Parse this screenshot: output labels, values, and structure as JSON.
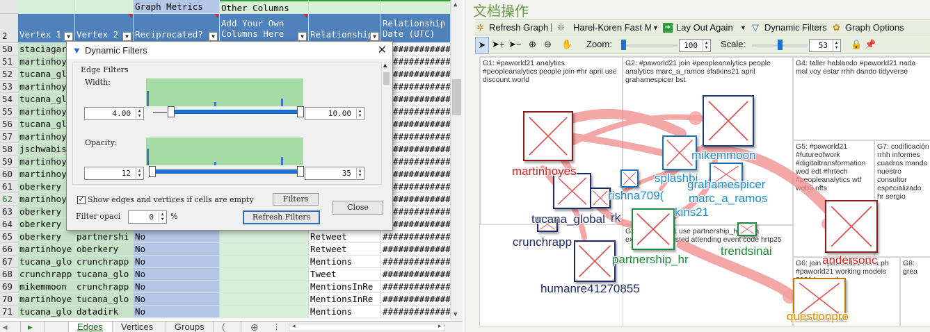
{
  "sheet": {
    "group_headers": {
      "graph_metrics": "Graph Metrics",
      "other_columns": "Other Columns"
    },
    "header_row_number": "2",
    "columns": [
      "Vertex 1",
      "Vertex 2",
      "Reciprocated?",
      "Add Your Own Columns Here",
      "Relationship",
      "Relationship Date (UTC)"
    ],
    "rows": [
      {
        "n": "50",
        "v1": "staciagar",
        "v2": "",
        "rec": "",
        "rel": "",
        "date": "#############"
      },
      {
        "n": "51",
        "v1": "martinhoy",
        "v2": "",
        "rec": "",
        "rel": "",
        "date": "#############"
      },
      {
        "n": "52",
        "v1": "tucana_gl",
        "v2": "",
        "rec": "",
        "rel": "",
        "date": "#############"
      },
      {
        "n": "53",
        "v1": "martinhoy",
        "v2": "",
        "rec": "",
        "rel": "",
        "date": "#############"
      },
      {
        "n": "54",
        "v1": "tucana_gl",
        "v2": "",
        "rec": "",
        "rel": "",
        "date": "#############"
      },
      {
        "n": "55",
        "v1": "martinhoy",
        "v2": "",
        "rec": "",
        "rel": "",
        "date": "#############"
      },
      {
        "n": "56",
        "v1": "tucana_gl",
        "v2": "",
        "rec": "",
        "rel": "",
        "date": "#############"
      },
      {
        "n": "57",
        "v1": "martinhoy",
        "v2": "",
        "rec": "",
        "rel": "",
        "date": "#############"
      },
      {
        "n": "58",
        "v1": "jschwabis",
        "v2": "",
        "rec": "",
        "rel": "",
        "date": "#############"
      },
      {
        "n": "59",
        "v1": "martinhoy",
        "v2": "",
        "rec": "",
        "rel": "",
        "date": "#############"
      },
      {
        "n": "60",
        "v1": "martinhoy",
        "v2": "",
        "rec": "",
        "rel": "",
        "date": "#############"
      },
      {
        "n": "61",
        "v1": "oberkery",
        "v2": "",
        "rec": "",
        "rel": "",
        "date": "#############"
      },
      {
        "n": "62",
        "v1": "martinhoy",
        "v2": "",
        "rec": "",
        "rel": "",
        "date": "#############"
      },
      {
        "n": "63",
        "v1": "oberkery",
        "v2": "",
        "rec": "",
        "rel": "",
        "date": "#############"
      },
      {
        "n": "64",
        "v1": "oberkery",
        "v2": "",
        "rec": "",
        "rel": "",
        "date": "#############"
      },
      {
        "n": "65",
        "v1": "oberkery",
        "v2": "partnershi",
        "rec": "No",
        "rel": "Retweet",
        "date": "#############"
      },
      {
        "n": "66",
        "v1": "martinhoye",
        "v2": "oberkery",
        "rec": "No",
        "rel": "Retweet",
        "date": "#############"
      },
      {
        "n": "67",
        "v1": "tucana_glo",
        "v2": "crunchrapp",
        "rec": "No",
        "rel": "Mentions",
        "date": "#############"
      },
      {
        "n": "68",
        "v1": "crunchrapp",
        "v2": "tucana_glo",
        "rec": "No",
        "rel": "Tweet",
        "date": "#############"
      },
      {
        "n": "69",
        "v1": "mikemmoon",
        "v2": "crunchrapp",
        "rec": "No",
        "rel": "MentionsInRe",
        "date": "#############"
      },
      {
        "n": "70",
        "v1": "martinhoye",
        "v2": "tucana_glo",
        "rec": "No",
        "rel": "MentionsInRe",
        "date": "#############"
      },
      {
        "n": "71",
        "v1": "tucana_glo",
        "v2": "datadirk",
        "rec": "No",
        "rel": "Mentions",
        "date": "#############"
      }
    ],
    "tabs": [
      "Edges",
      "Vertices",
      "Groups",
      "("
    ]
  },
  "dialog": {
    "title": "Dynamic Filters",
    "edge_filters_label": "Edge Filters",
    "width_label": "Width:",
    "width_min": "4.00",
    "width_max": "10.00",
    "opacity_label": "Opacity:",
    "opacity_min": "12",
    "opacity_max": "35",
    "width_hist": [
      0.55,
      0.15,
      0.28
    ],
    "opacity_hist": [
      0.6,
      0.12,
      0.3
    ],
    "show_empty_label": "Show edges and vertices if cells are empty",
    "show_empty_checked": true,
    "filters_button": "Filters",
    "filter_opacity_label": "Filter opaci",
    "filter_opacity_value": "0",
    "percent": "%",
    "close_button": "Close",
    "refresh_button": "Refresh Filters"
  },
  "panel": {
    "title": "文档操作",
    "toolbar1": {
      "refresh": "Refresh Graph",
      "layout": "Harel-Koren Fast M",
      "layout_again": "Lay Out Again",
      "dynamic_filters": "Dynamic Filters",
      "graph_options": "Graph Options"
    },
    "toolbar2": {
      "zoom_label": "Zoom:",
      "zoom_value": "100",
      "scale_label": "Scale:",
      "scale_value": "53"
    },
    "groups": {
      "g1": "G1: #paworld21 analytics #peopleanalytics people join #hr april use discount world",
      "g2": "G2: #paworld21 join #peopleanalytics people analytics marc_a_ramos sfatkins21 april grahamespicer bst",
      "g3": "G3: #paworld21 use partnership_hr listen exploring interested attending event code hrtp25",
      "g4": "G4: taller hablando #paworld21 nada mal voy estar rrhh dando tidyverse",
      "g5": "G5: #paworld21 #futureofwork #digitaltransformation wed edt #hrtech #peopleanalytics wtf web3 nfts",
      "g6": "G6: join #paworld21 mina ph #paworld21 working models 2021 beyond",
      "g7": "G7: codificación rrhh informes cuadros mando nuestro consultor especializado hr sergio",
      "g8": "G8: grea"
    },
    "vertices": {
      "martinhoyes": "martinhoyes",
      "mikemmoon": "mikemmoon",
      "splashbi": "splashbi",
      "grahamespicer": "grahamespicer",
      "marc_a_ramos": "marc_a_ramos",
      "krishna": "rishna709(",
      "rk": "rk",
      "sfatkins21": "kins21",
      "tucana_global": "tucana_global",
      "crunchrapp": "crunchrapp",
      "partnership_hr": "partnership_hr",
      "trendsinai": "trendsinai",
      "humanre": "humanre41270855",
      "andersonc": "andersonc",
      "questionpro": "questionpro"
    },
    "colors": {
      "red_label": "#e01b1b",
      "blue_label": "#1a8cd8",
      "navy_label": "#1d2a66",
      "green_label": "#1a8a3a",
      "orange_label": "#e08a00",
      "edge": "#f4a0a0"
    }
  }
}
